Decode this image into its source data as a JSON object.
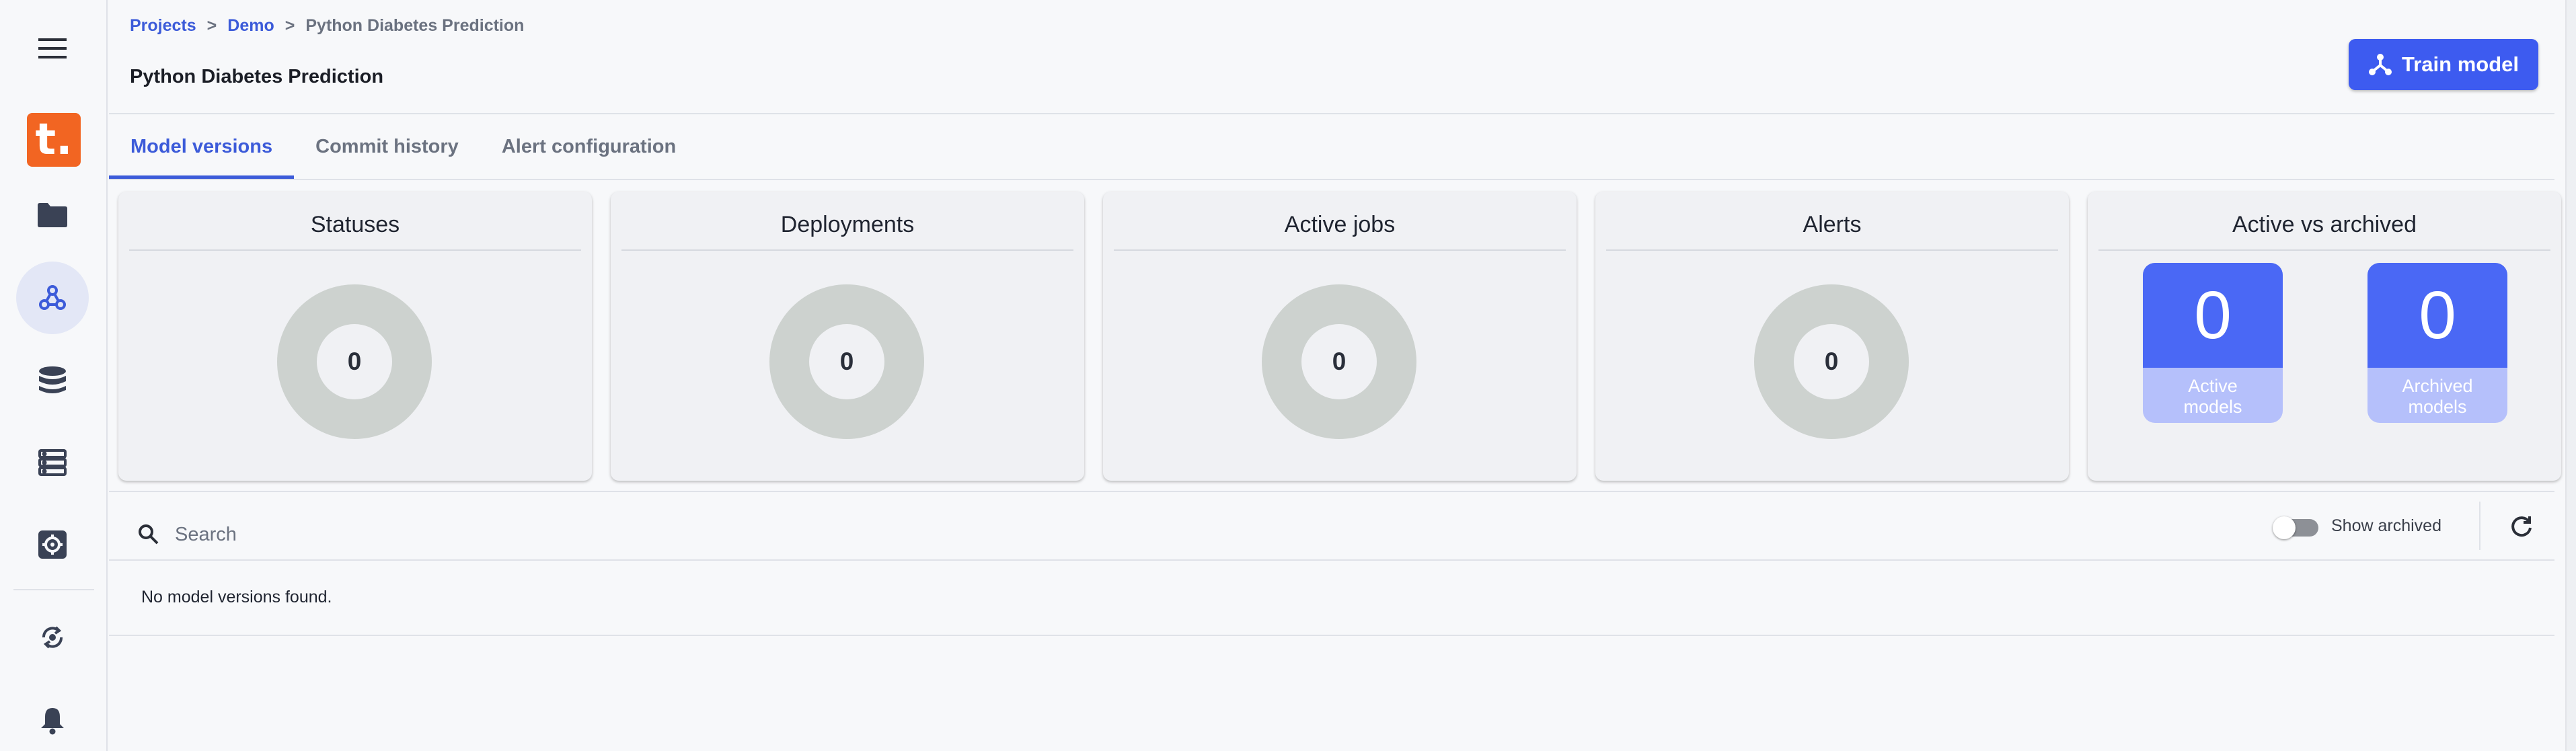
{
  "sidebar": {
    "logo_letter": "t.",
    "items": [
      {
        "icon": "menu-icon"
      },
      {
        "icon": "folder-icon"
      },
      {
        "icon": "models-icon",
        "active": true
      },
      {
        "icon": "database-icon"
      },
      {
        "icon": "server-icon"
      },
      {
        "icon": "settings-icon"
      },
      {
        "icon": "sync-icon"
      },
      {
        "icon": "bell-icon"
      }
    ]
  },
  "breadcrumb": {
    "items": [
      "Projects",
      "Demo",
      "Python Diabetes Prediction"
    ],
    "separator": ">"
  },
  "page": {
    "title": "Python Diabetes Prediction"
  },
  "actions": {
    "train_model": "Train model"
  },
  "tabs": [
    {
      "label": "Model versions",
      "active": true
    },
    {
      "label": "Commit history",
      "active": false
    },
    {
      "label": "Alert configuration",
      "active": false
    }
  ],
  "cards": {
    "statuses": {
      "title": "Statuses",
      "value": "0"
    },
    "deployments": {
      "title": "Deployments",
      "value": "0"
    },
    "active_jobs": {
      "title": "Active jobs",
      "value": "0"
    },
    "alerts": {
      "title": "Alerts",
      "value": "0"
    },
    "active_vs_archived": {
      "title": "Active vs archived",
      "active": {
        "value": "0",
        "label_line1": "Active",
        "label_line2": "models"
      },
      "archived": {
        "value": "0",
        "label_line1": "Archived",
        "label_line2": "models"
      }
    }
  },
  "search": {
    "placeholder": "Search",
    "value": ""
  },
  "show_archived": {
    "label": "Show archived",
    "checked": false
  },
  "empty_message": "No model versions found.",
  "colors": {
    "accent": "#3d5bf0",
    "logo": "#f26522",
    "donut_empty": "#cdd2cf",
    "stat_box": "#4a68f5",
    "stat_box_label": "#b5c0fb"
  }
}
